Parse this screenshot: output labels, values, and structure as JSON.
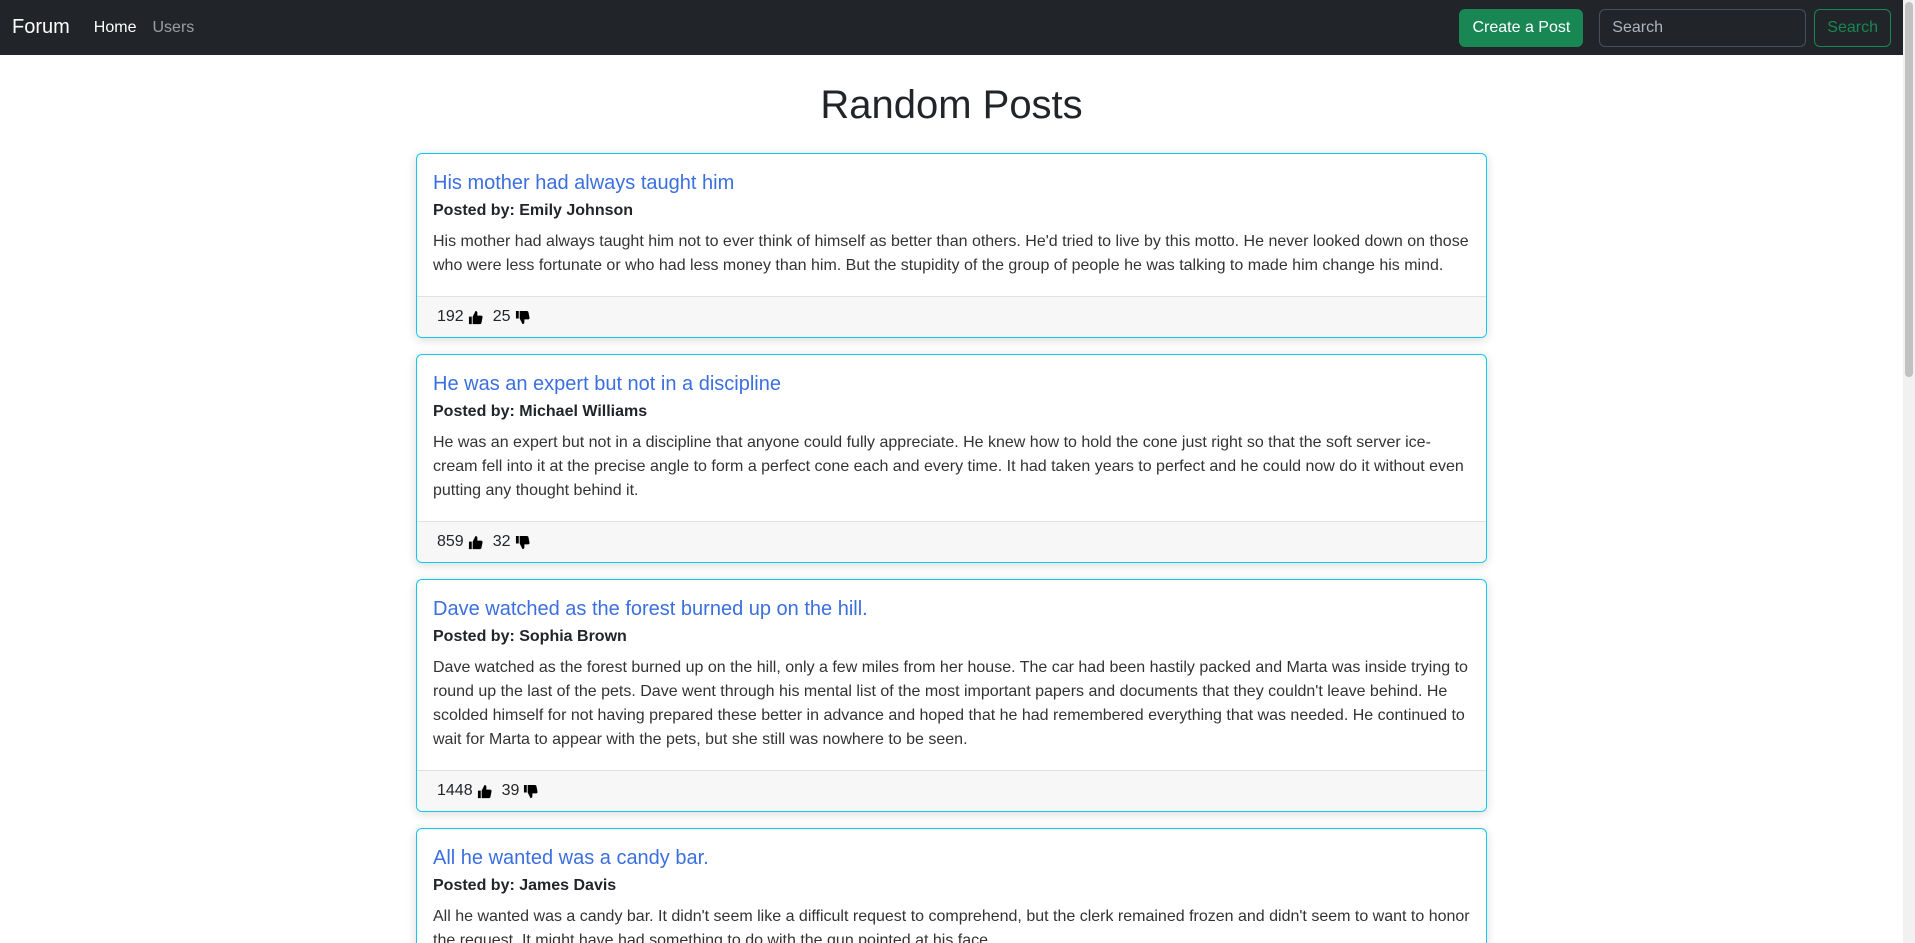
{
  "navbar": {
    "brand": "Forum",
    "links": [
      {
        "label": "Home"
      },
      {
        "label": "Users"
      }
    ],
    "create_button": "Create a Post",
    "search_placeholder": "Search",
    "search_button": "Search"
  },
  "page_title": "Random Posts",
  "posts": [
    {
      "title": "His mother had always taught him",
      "author": "Posted by: Emily Johnson",
      "body": "His mother had always taught him not to ever think of himself as better than others. He'd tried to live by this motto. He never looked down on those who were less fortunate or who had less money than him. But the stupidity of the group of people he was talking to made him change his mind.",
      "likes": "192",
      "dislikes": "25"
    },
    {
      "title": "He was an expert but not in a discipline",
      "author": "Posted by: Michael Williams",
      "body": "He was an expert but not in a discipline that anyone could fully appreciate. He knew how to hold the cone just right so that the soft server ice-cream fell into it at the precise angle to form a perfect cone each and every time. It had taken years to perfect and he could now do it without even putting any thought behind it.",
      "likes": "859",
      "dislikes": "32"
    },
    {
      "title": "Dave watched as the forest burned up on the hill.",
      "author": "Posted by: Sophia Brown",
      "body": "Dave watched as the forest burned up on the hill, only a few miles from her house. The car had been hastily packed and Marta was inside trying to round up the last of the pets. Dave went through his mental list of the most important papers and documents that they couldn't leave behind. He scolded himself for not having prepared these better in advance and hoped that he had remembered everything that was needed. He continued to wait for Marta to appear with the pets, but she still was nowhere to be seen.",
      "likes": "1448",
      "dislikes": "39"
    },
    {
      "title": "All he wanted was a candy bar.",
      "author": "Posted by: James Davis",
      "body": "All he wanted was a candy bar. It didn't seem like a difficult request to comprehend, but the clerk remained frozen and didn't seem to want to honor the request. It might have had something to do with the gun pointed at his face.",
      "likes": "",
      "dislikes": ""
    }
  ],
  "icons": {
    "like": "thumbs-up-icon",
    "dislike": "thumbs-down-icon"
  },
  "colors": {
    "navbar_bg": "#212529",
    "success": "#198754",
    "card_border": "#0dcaf0",
    "link": "#3b6fe0"
  }
}
